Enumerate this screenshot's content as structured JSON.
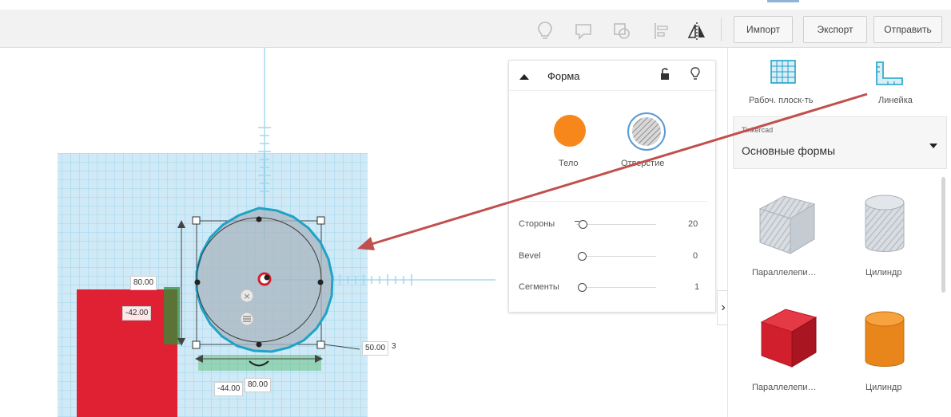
{
  "toolbar": {
    "icons": [
      "lightbulb-icon",
      "speech-bubble-icon",
      "group-icon",
      "align-icon",
      "mirror-icon"
    ],
    "import_label": "Импорт",
    "export_label": "Экспорт",
    "send_label": "Отправить"
  },
  "shape_panel": {
    "title": "Форма",
    "solid_label": "Тело",
    "hole_label": "Отверстие",
    "colors": {
      "solid": "#f7861b",
      "hole": "#c9c9c9"
    },
    "params": [
      {
        "label": "Стороны",
        "value": "20",
        "fraction": 0.0
      },
      {
        "label": "Bevel",
        "value": "0",
        "fraction": 0.0
      },
      {
        "label": "Сегменты",
        "value": "1",
        "fraction": 0.0
      }
    ]
  },
  "right_panel": {
    "workplane_label": "Рабоч. плоск-ть",
    "ruler_label": "Линейка",
    "library_caption": "Tinkercad",
    "library_value": "Основные формы",
    "shapes": [
      {
        "label": "Параллелепи…",
        "icon": "striped-box-icon"
      },
      {
        "label": "Цилиндр",
        "icon": "striped-cylinder-icon"
      },
      {
        "label": "Параллелепи…",
        "icon": "red-box-icon"
      },
      {
        "label": "Цилиндр",
        "icon": "orange-cylinder-icon"
      }
    ]
  },
  "workplane": {
    "dims": {
      "height": "80.00",
      "y_offset": "-42.00",
      "x_offset": "-44.00",
      "width": "80.00",
      "z_value": "50.00",
      "z_suffix": "3"
    }
  },
  "colors": {
    "accent": "#1fa3c6",
    "grid": "#cfe9f6",
    "red_shape": "#e02033",
    "arrow": "#c0504d"
  }
}
